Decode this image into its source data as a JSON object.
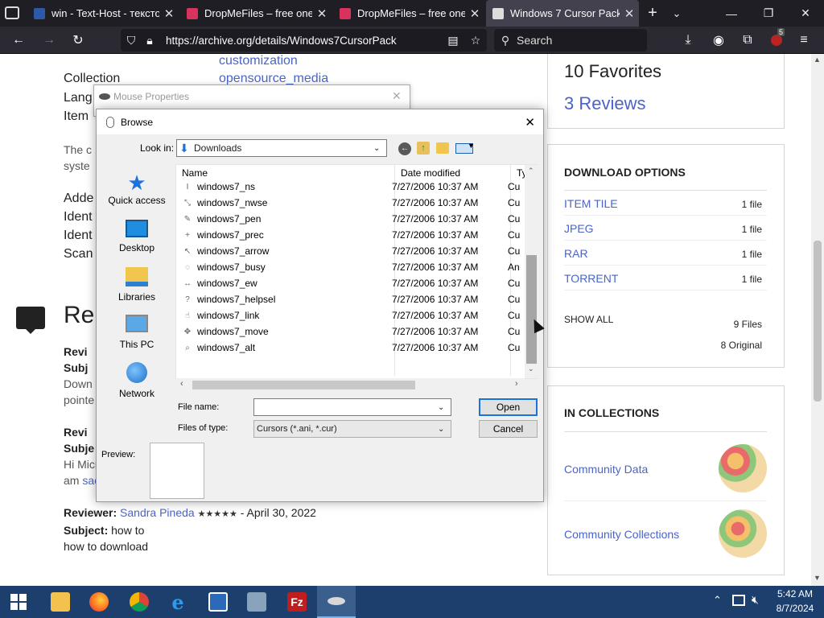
{
  "browser": {
    "tabs": [
      {
        "title": "win - Text-Host - текстов",
        "icon": "text-host-icon",
        "active": false
      },
      {
        "title": "DropMeFiles – free one-c",
        "icon": "dropmefiles-icon",
        "active": false
      },
      {
        "title": "DropMeFiles – free one-c",
        "icon": "dropmefiles-icon",
        "active": false
      },
      {
        "title": "Windows 7 Cursor Pack :",
        "icon": "archive-icon",
        "active": true
      }
    ],
    "url": "https://archive.org/details/Windows7CursorPack",
    "search_placeholder": "Search",
    "extension_badge": "5"
  },
  "page": {
    "tags": [
      "customization",
      "opensource_media"
    ],
    "meta_labels": [
      "Collection",
      "Lang",
      "Item",
      "The c",
      "syste",
      "Adde",
      "Ident",
      "Ident",
      "Scan"
    ],
    "reviews_heading": "Re",
    "partial_reviews": [
      {
        "reviewer_label": "Revi",
        "subject_label": "Subj",
        "body": [
          "Down",
          "pointe"
        ]
      },
      {
        "reviewer_label": "Revi",
        "subject_label": "Subje",
        "body": [
          "Hi Micr",
          "am "
        ],
        "link": "sac"
      }
    ],
    "review": {
      "reviewer_label": "Reviewer:",
      "reviewer": "Sandra Pineda",
      "stars": "★★★★★",
      "date": "- April 30, 2022",
      "subject_label": "Subject:",
      "subject": "how to",
      "body": "how to download"
    },
    "stats": {
      "favorites": "10 Favorites",
      "reviews": "3 Reviews"
    },
    "download_options": {
      "heading": "DOWNLOAD OPTIONS",
      "rows": [
        {
          "label": "ITEM TILE",
          "count": "1 file"
        },
        {
          "label": "JPEG",
          "count": "1 file"
        },
        {
          "label": "RAR",
          "count": "1 file"
        },
        {
          "label": "TORRENT",
          "count": "1 file"
        }
      ],
      "show_all": "SHOW ALL",
      "files": "9 Files",
      "original": "8 Original"
    },
    "collections": {
      "heading": "IN COLLECTIONS",
      "items": [
        "Community Data",
        "Community Collections"
      ]
    }
  },
  "mouse_properties": {
    "title": "Mouse Properties"
  },
  "browse_dialog": {
    "title": "Browse",
    "look_in_label": "Look in:",
    "look_in_value": "Downloads",
    "places": [
      "Quick access",
      "Desktop",
      "Libraries",
      "This PC",
      "Network"
    ],
    "columns": [
      "Name",
      "Date modified",
      "Ty"
    ],
    "files": [
      {
        "name": "windows7_ns",
        "date": "7/27/2006 10:37 AM",
        "type": "Cu",
        "icon": "I"
      },
      {
        "name": "windows7_nwse",
        "date": "7/27/2006 10:37 AM",
        "type": "Cu",
        "icon": "⤡"
      },
      {
        "name": "windows7_pen",
        "date": "7/27/2006 10:37 AM",
        "type": "Cu",
        "icon": "✎"
      },
      {
        "name": "windows7_prec",
        "date": "7/27/2006 10:37 AM",
        "type": "Cu",
        "icon": "+"
      },
      {
        "name": "windows7_arrow",
        "date": "7/27/2006 10:37 AM",
        "type": "Cu",
        "icon": "↖"
      },
      {
        "name": "windows7_busy",
        "date": "7/27/2006 10:37 AM",
        "type": "An",
        "icon": "◌"
      },
      {
        "name": "windows7_ew",
        "date": "7/27/2006 10:37 AM",
        "type": "Cu",
        "icon": "↔"
      },
      {
        "name": "windows7_helpsel",
        "date": "7/27/2006 10:37 AM",
        "type": "Cu",
        "icon": "?"
      },
      {
        "name": "windows7_link",
        "date": "7/27/2006 10:37 AM",
        "type": "Cu",
        "icon": "☝"
      },
      {
        "name": "windows7_move",
        "date": "7/27/2006 10:37 AM",
        "type": "Cu",
        "icon": "✥"
      },
      {
        "name": "windows7_alt",
        "date": "7/27/2006 10:37 AM",
        "type": "Cu",
        "icon": "⌕"
      }
    ],
    "file_name_label": "File name:",
    "file_name_value": "",
    "files_of_type_label": "Files of type:",
    "files_of_type_value": "Cursors (*.ani, *.cur)",
    "open_button": "Open",
    "cancel_button": "Cancel",
    "preview_label": "Preview:"
  },
  "taskbar": {
    "time": "5:42 AM",
    "date": "8/7/2024"
  }
}
